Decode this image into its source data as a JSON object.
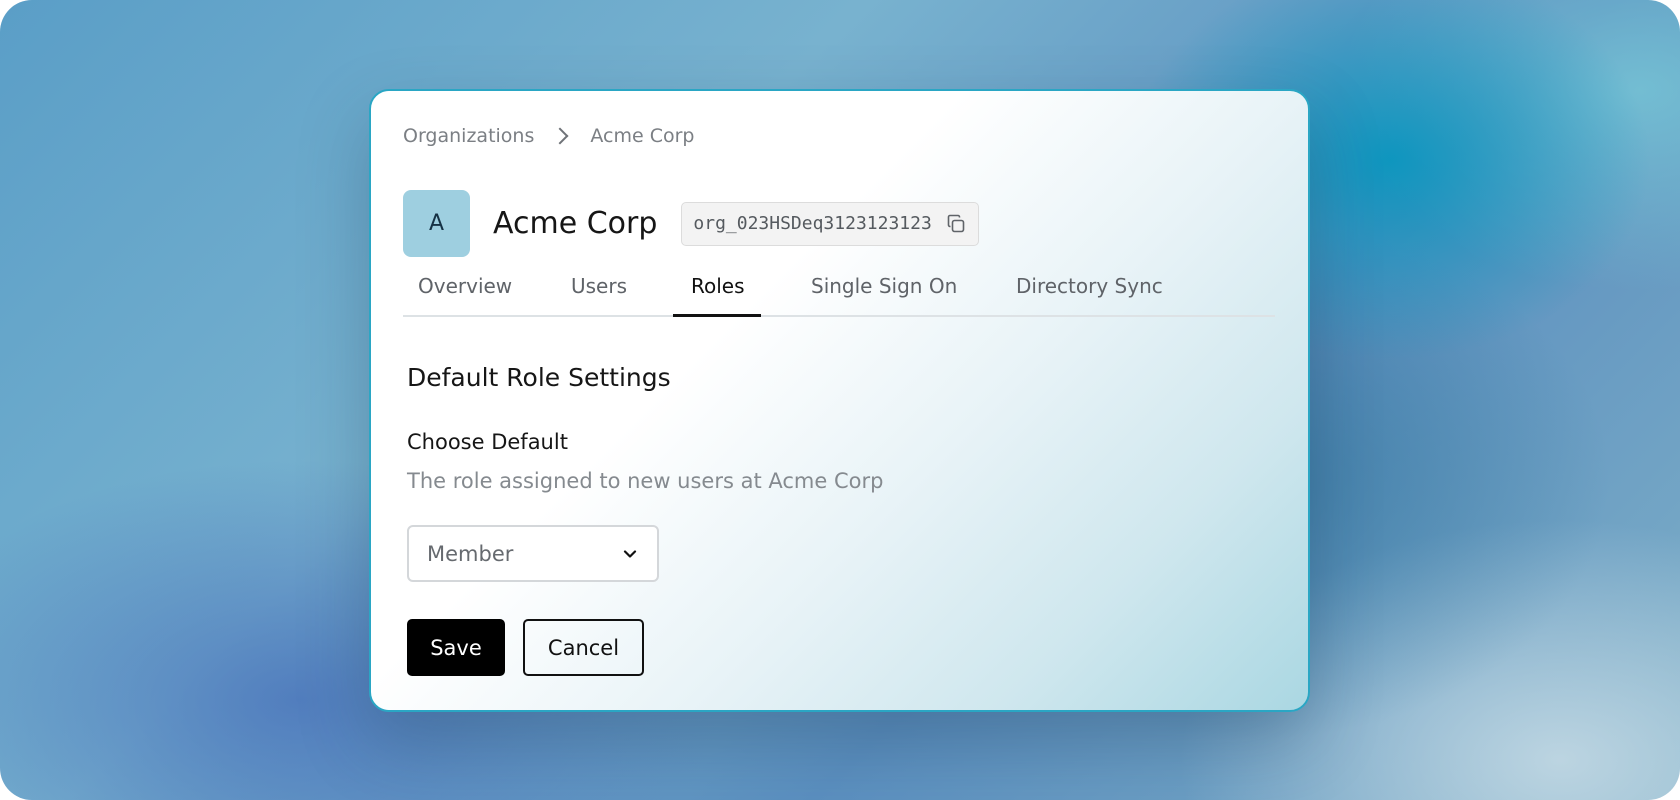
{
  "breadcrumb": {
    "items": [
      "Organizations",
      "Acme Corp"
    ]
  },
  "organization": {
    "avatar_letter": "A",
    "name": "Acme Corp",
    "id": "org_023HSDeq3123123123",
    "copy_icon": "copy-icon"
  },
  "tabs": [
    {
      "label": "Overview",
      "active": false
    },
    {
      "label": "Users",
      "active": false
    },
    {
      "label": "Roles",
      "active": true
    },
    {
      "label": "Single Sign On",
      "active": false
    },
    {
      "label": "Directory Sync",
      "active": false
    }
  ],
  "section": {
    "title": "Default Role Settings",
    "field_label": "Choose Default",
    "field_help": "The role assigned to new users at Acme Corp",
    "select_value": "Member"
  },
  "actions": {
    "save_label": "Save",
    "cancel_label": "Cancel"
  },
  "colors": {
    "accent_border": "#2aa6c4",
    "avatar_bg": "#9ecfe0",
    "primary_button": "#000000"
  }
}
